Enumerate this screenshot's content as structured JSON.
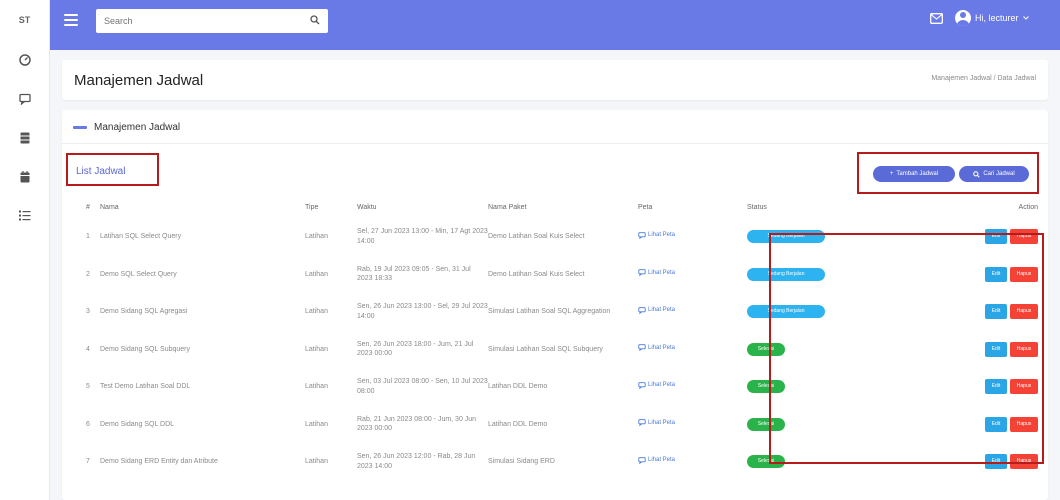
{
  "sidebar": {
    "brand": "ST",
    "nav_icons": [
      "dashboard-icon",
      "chat-icon",
      "database-icon",
      "calendar-icon",
      "list-icon"
    ]
  },
  "topbar": {
    "search_placeholder": "Search",
    "user_name": "Hi, lecturer"
  },
  "page": {
    "title": "Manajemen Jadwal",
    "breadcrumb": "Manajemen Jadwal / Data Jadwal"
  },
  "card": {
    "header_title": "Manajemen Jadwal",
    "list_title": "List Jadwal",
    "tambah_label": "Tambah Jadwal",
    "cari_label": "Cari Jadwal"
  },
  "table": {
    "headers": [
      "#",
      "Nama",
      "Tipe",
      "Waktu",
      "Nama Paket",
      "Peta",
      "Status",
      "Action"
    ],
    "rows": [
      {
        "no": "1",
        "nama": "Latihan SQL Select Query",
        "tipe": "Latihan",
        "waktu": "Sel, 27 Jun 2023 13:00 - Min, 17 Agt 2023 14:00",
        "paket": "Demo Latihan Soal Kuis Select",
        "peta": "Lihat Peta",
        "status": "Sedang Berjalan",
        "status_type": "blue",
        "edit": "Edit",
        "hapus": "Hapus"
      },
      {
        "no": "2",
        "nama": "Demo SQL Select Query",
        "tipe": "Latihan",
        "waktu": "Rab, 19 Jul 2023 09:05 - Sen, 31 Jul 2023 18:33",
        "paket": "Demo Latihan Soal Kuis Select",
        "peta": "Lihat Peta",
        "status": "Sedang Berjalan",
        "status_type": "blue",
        "edit": "Edit",
        "hapus": "Hapus"
      },
      {
        "no": "3",
        "nama": "Demo Sidang SQL Agregasi",
        "tipe": "Latihan",
        "waktu": "Sen, 26 Jun 2023 13:00 - Sel, 29 Jul 2023 14:00",
        "paket": "Simulasi Latihan Soal SQL Aggregation",
        "peta": "Lihat Peta",
        "status": "Sedang Berjalan",
        "status_type": "blue",
        "edit": "Edit",
        "hapus": "Hapus"
      },
      {
        "no": "4",
        "nama": "Demo Sidang SQL Subquery",
        "tipe": "Latihan",
        "waktu": "Sen, 26 Jun 2023 18:00 - Jum, 21 Jul 2023 00:00",
        "paket": "Simulasi Latihan Soal SQL Subquery",
        "peta": "Lihat Peta",
        "status": "Selesai",
        "status_type": "green",
        "edit": "Edit",
        "hapus": "Hapus"
      },
      {
        "no": "5",
        "nama": "Test Demo Latihan Soal DDL",
        "tipe": "Latihan",
        "waktu": "Sen, 03 Jul 2023 08:00 - Sen, 10 Jul 2023 08:00",
        "paket": "Latihan DDL Demo",
        "peta": "Lihat Peta",
        "status": "Selesai",
        "status_type": "green",
        "edit": "Edit",
        "hapus": "Hapus"
      },
      {
        "no": "6",
        "nama": "Demo Sidang SQL DDL",
        "tipe": "Latihan",
        "waktu": "Rab, 21 Jun 2023 08:00 - Jum, 30 Jun 2023 00:00",
        "paket": "Latihan DDL Demo",
        "peta": "Lihat Peta",
        "status": "Selesai",
        "status_type": "green",
        "edit": "Edit",
        "hapus": "Hapus"
      },
      {
        "no": "7",
        "nama": "Demo Sidang ERD Entity dan Atribute",
        "tipe": "Latihan",
        "waktu": "Sen, 26 Jun 2023 12:00 - Rab, 28 Jun 2023 14:00",
        "paket": "Simulasi Sidang ERD",
        "peta": "Lihat Peta",
        "status": "Selesai",
        "status_type": "green",
        "edit": "Edit",
        "hapus": "Hapus"
      }
    ]
  }
}
